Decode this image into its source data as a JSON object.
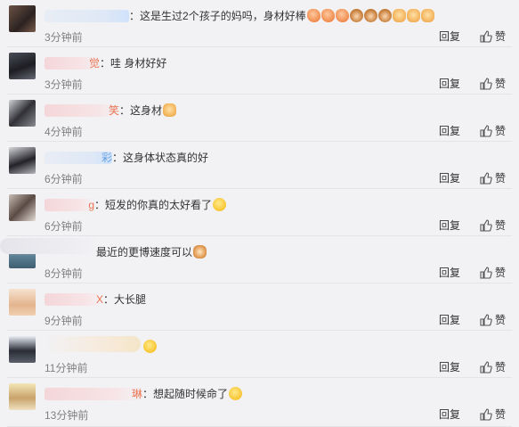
{
  "comments": [
    {
      "user_tail": "",
      "user_style": "blue",
      "colon": "：",
      "text": "这是生过2个孩子的妈吗，身材好棒",
      "emojis": [
        "e-muscle",
        "e-muscle",
        "e-muscle",
        "e-monkey",
        "e-monkey",
        "e-monkey",
        "e-fist",
        "e-fist",
        "e-fist"
      ],
      "time": "3分钟前",
      "reply": "回复",
      "like": "赞"
    },
    {
      "user_tail": "觉",
      "user_style": "pink",
      "colon": "：",
      "text": "哇 身材好好",
      "emojis": [],
      "time": "3分钟前",
      "reply": "回复",
      "like": "赞"
    },
    {
      "user_tail": "笑",
      "user_style": "pink",
      "colon": "：",
      "text": "这身材",
      "emojis": [
        "e-thumb"
      ],
      "time": "4分钟前",
      "reply": "回复",
      "like": "赞"
    },
    {
      "user_tail": "彩",
      "user_style": "blue",
      "colon": "：",
      "text": "这身体状态真的好",
      "emojis": [],
      "time": "6分钟前",
      "reply": "回复",
      "like": "赞"
    },
    {
      "user_tail": "g",
      "user_style": "pink",
      "colon": "：",
      "text": "短发的你真的太好看了",
      "emojis": [
        "e-kiss"
      ],
      "time": "6分钟前",
      "reply": "回复",
      "like": "赞"
    },
    {
      "user_tail": "",
      "user_style": "pink",
      "colon": "",
      "text": "最近的更博速度可以",
      "emojis": [
        "e-cat"
      ],
      "time": "8分钟前",
      "reply": "回复",
      "like": "赞"
    },
    {
      "user_tail": "X",
      "user_style": "pink",
      "colon": "：",
      "text": "大长腿",
      "emojis": [],
      "time": "9分钟前",
      "reply": "回复",
      "like": "赞"
    },
    {
      "user_tail": "",
      "user_style": "pink",
      "colon": "",
      "text": "",
      "emojis": [
        "e-laugh"
      ],
      "time": "11分钟前",
      "reply": "回复",
      "like": "赞"
    },
    {
      "user_tail": "琳",
      "user_style": "pink",
      "colon": "：",
      "text": "想起随时候命了",
      "emojis": [
        "e-tongue"
      ],
      "time": "13分钟前",
      "reply": "回复",
      "like": "赞"
    }
  ],
  "icons": {
    "like": "thumbs-up-icon"
  },
  "colors": {
    "time": "#808080",
    "username": "#eb7350",
    "background": "#f2f2f5"
  }
}
